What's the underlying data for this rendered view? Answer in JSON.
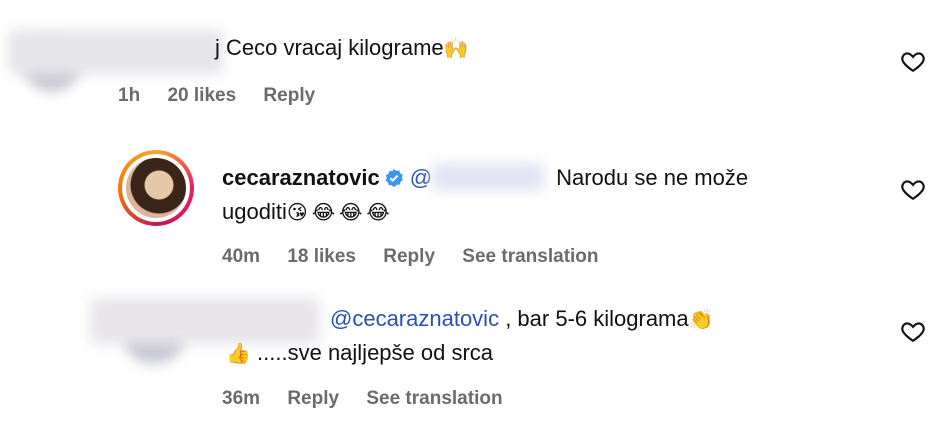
{
  "comments": [
    {
      "text_suffix": "j Ceco vracaj kilograme",
      "emoji": "🙌",
      "time": "1h",
      "likes": "20 likes",
      "reply": "Reply"
    },
    {
      "username": "cecaraznatovic",
      "mention_blur": "@",
      "text_line1": "Narodu se ne može",
      "text_line2": "ugoditi",
      "emojis": "😘😂😂😂",
      "time": "40m",
      "likes": "18 likes",
      "reply": "Reply",
      "translate": "See translation"
    },
    {
      "mention": "@cecaraznatovic",
      "text_line1": ", bar 5-6 kilograma",
      "emoji1": "👏",
      "emoji2": "👍",
      "text_line2": ".....sve najljepše od srca",
      "time": "36m",
      "reply": "Reply",
      "translate": "See translation"
    }
  ],
  "colors": {
    "mention": "#2b50b5",
    "meta": "#6b6b6b",
    "verified": "#3897f0"
  }
}
